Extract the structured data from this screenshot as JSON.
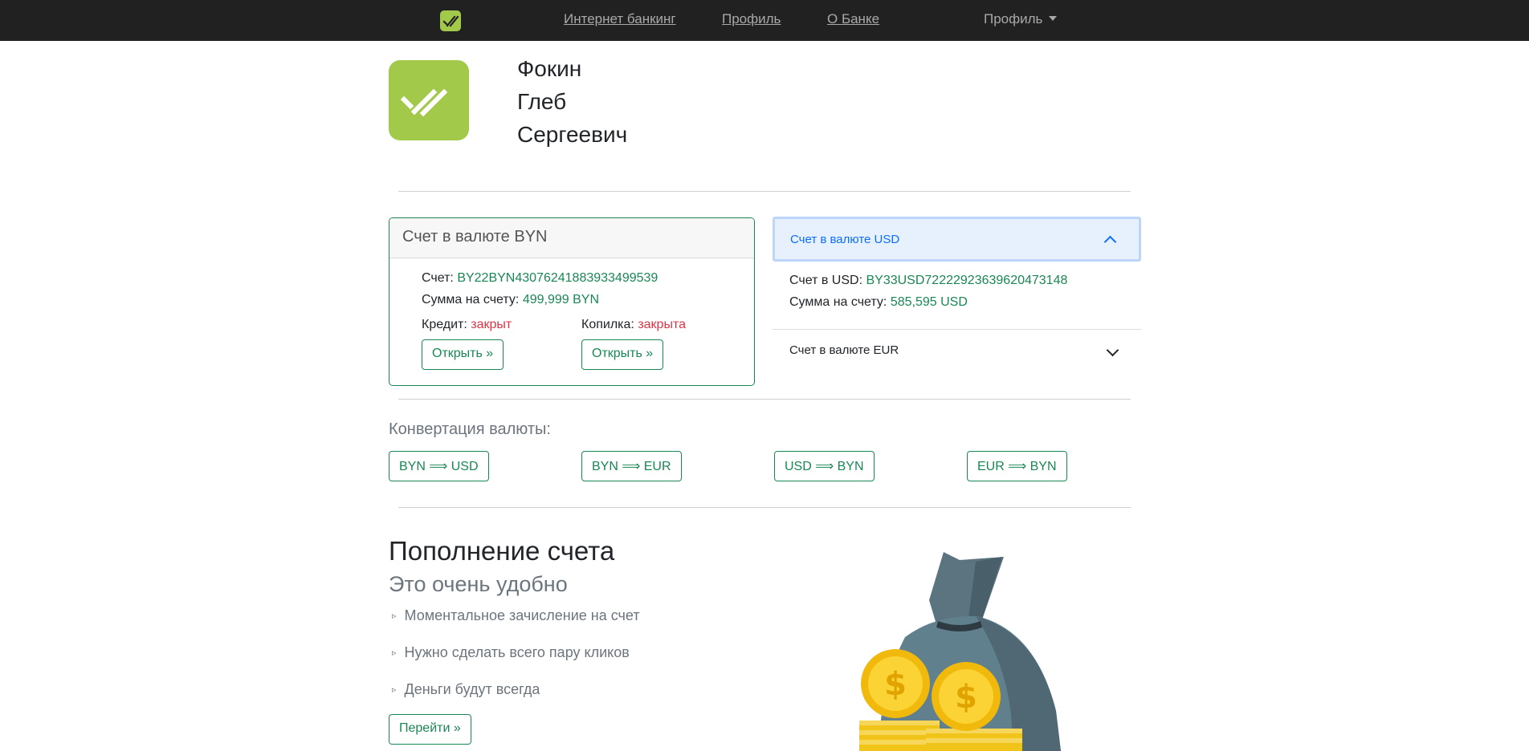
{
  "nav": {
    "links": [
      "Интернет банкинг",
      "Профиль",
      "О Банке"
    ],
    "dropdown_label": "Профиль",
    "logo_icon": "bank-logo-icon"
  },
  "profile": {
    "surname": "Фокин",
    "first_name": "Глеб",
    "patronymic": "Сергеевич"
  },
  "byn_card": {
    "title": "Счет в валюте BYN",
    "account_label": "Счет:",
    "account_number": "BY22BYN43076241883933499539",
    "balance_label": "Сумма на счету:",
    "balance": "499,999 BYN",
    "credit_label": "Кредит:",
    "credit_status": "закрыт",
    "piggy_label": "Копилка:",
    "piggy_status": "закрыта",
    "open_button": "Открыть »"
  },
  "usd_accordion": {
    "title": "Счет в валюте USD",
    "account_label": "Счет в USD:",
    "account_number": "BY33USD72222923639620473148",
    "balance_label": "Сумма на счету:",
    "balance": "585,595 USD"
  },
  "eur_accordion": {
    "title": "Счет в валюте EUR"
  },
  "conversion": {
    "title": "Конвертация валюты:",
    "buttons": [
      "BYN ⟹ USD",
      "BYN ⟹ EUR",
      "USD ⟹ BYN",
      "EUR ⟹ BYN"
    ]
  },
  "deposit": {
    "title": "Пополнение счета",
    "subtitle": "Это очень удобно",
    "bullet": "▹",
    "features": [
      "Моментальное зачисление на счет",
      "Нужно сделать всего пару кликов",
      "Деньги будут всегда"
    ],
    "go_button": "Перейти »"
  },
  "colors": {
    "brand": "#a3c94a",
    "success": "#198754",
    "danger": "#dc3545",
    "primary": "#0d6efd"
  }
}
